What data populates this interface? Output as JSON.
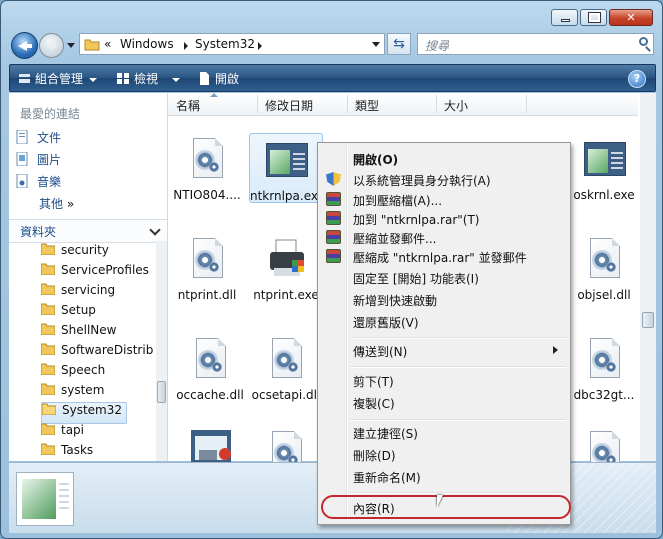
{
  "address_bar": {
    "prefix": "«",
    "crumbs": [
      "Windows",
      "System32"
    ]
  },
  "search": {
    "placeholder": "搜尋"
  },
  "toolbar": {
    "organize": "組合管理",
    "views": "檢視",
    "open": "開啟",
    "help": "?"
  },
  "nav": {
    "favorites_header": "最愛的連結",
    "favorites": [
      "文件",
      "圖片",
      "音樂"
    ],
    "more": "其他",
    "more_arrows": "»",
    "folders_header": "資料夾",
    "tree": [
      "security",
      "ServiceProfiles",
      "servicing",
      "Setup",
      "ShellNew",
      "SoftwareDistrib",
      "Speech",
      "system",
      "System32",
      "tapi",
      "Tasks"
    ],
    "selected_tree_item": "System32"
  },
  "columns": [
    "名稱",
    "修改日期",
    "類型",
    "大小"
  ],
  "files": [
    {
      "name": "NTIO804....",
      "type": "dll"
    },
    {
      "name": "ntkrnlpa.exe",
      "type": "exe"
    },
    {
      "name": "oskrnl.exe",
      "type": "exe"
    },
    {
      "name": "ntprint.dll",
      "type": "dll"
    },
    {
      "name": "ntprint.exe",
      "type": "printer"
    },
    {
      "name": "objsel.dll",
      "type": "dll"
    },
    {
      "name": "occache.dll",
      "type": "dll"
    },
    {
      "name": "ocsetapi.dll",
      "type": "dll"
    },
    {
      "name": "dbc32gt...",
      "type": "dll"
    }
  ],
  "context_menu": {
    "open": "開啟(O)",
    "run_as_admin": "以系統管理員身分執行(A)",
    "add_to_archive": "加到壓縮檔(A)...",
    "add_to_rar": "加到 \"ntkrnlpa.rar\"(T)",
    "compress_email": "壓縮並發郵件...",
    "compress_rar_email": "壓縮成 \"ntkrnlpa.rar\" 並發郵件",
    "pin_start": "固定至 [開始] 功能表(I)",
    "add_quick_launch": "新增到快速啟動",
    "restore_previous": "還原舊版(V)",
    "send_to": "傳送到(N)",
    "cut": "剪下(T)",
    "copy": "複製(C)",
    "create_shortcut": "建立捷徑(S)",
    "delete": "刪除(D)",
    "rename": "重新命名(M)",
    "properties": "內容(R)"
  },
  "colors": {
    "highlight_ring": "#c4272f",
    "toolbar": "#2a5583"
  }
}
